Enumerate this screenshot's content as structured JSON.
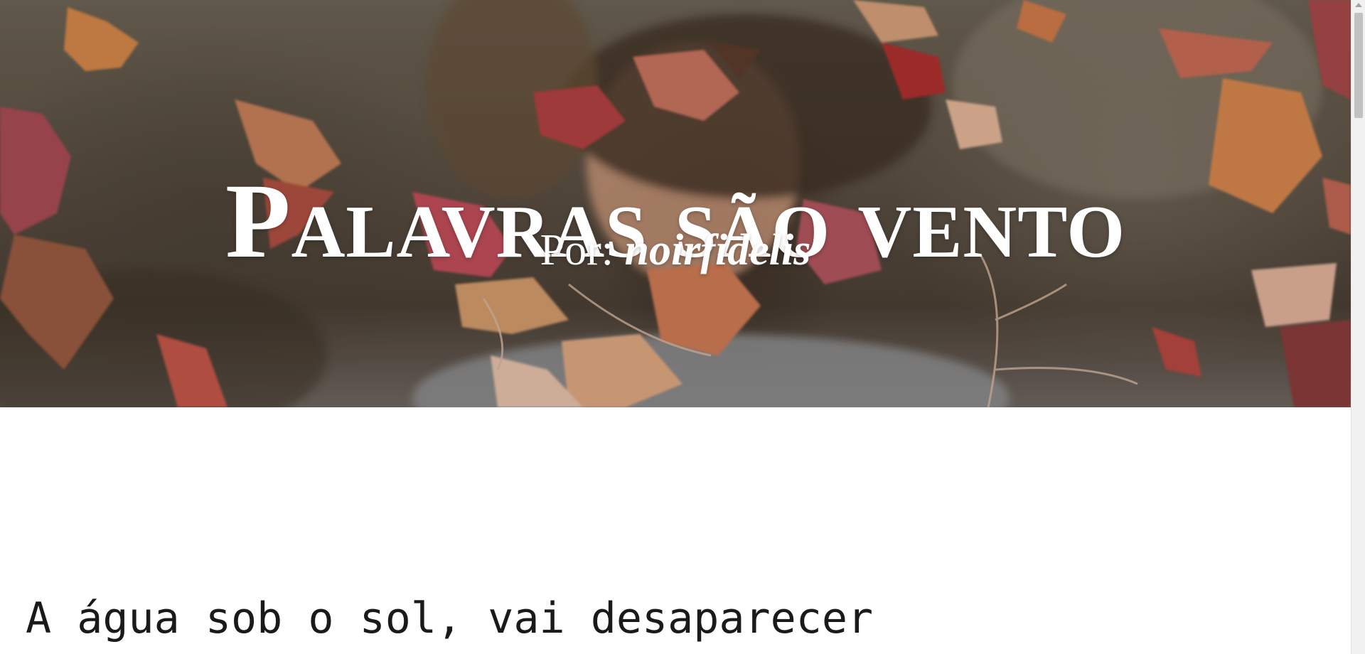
{
  "hero": {
    "title": "Palavras são vento",
    "byline_prefix": "Por: ",
    "author": "noirfidelis",
    "background_image": "autumn-leaves-photo"
  },
  "poem": {
    "lines": [
      "A água sob o sol, vai desaparecer"
    ]
  },
  "colors": {
    "title_text": "#ffffff",
    "body_text": "#1a1a1a",
    "page_background": "#ffffff"
  }
}
